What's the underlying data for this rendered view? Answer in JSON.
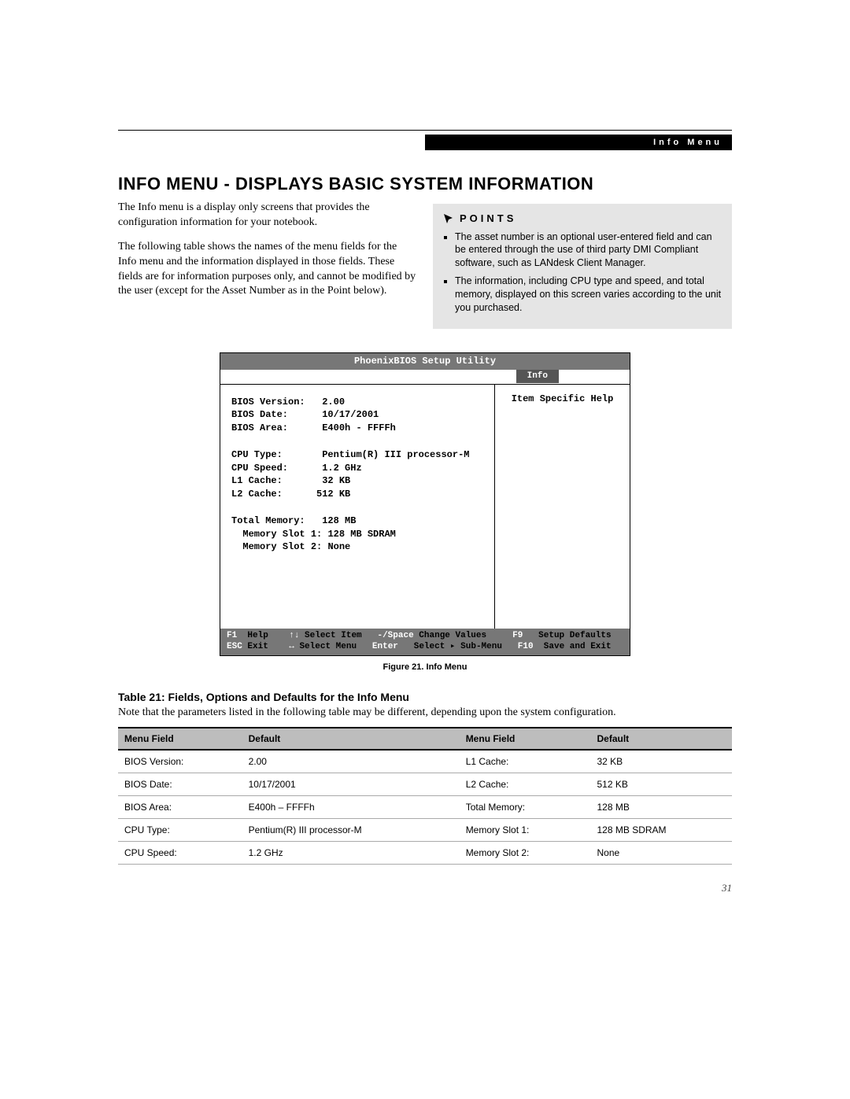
{
  "header": {
    "section_label": "Info Menu"
  },
  "heading": "INFO MENU - DISPLAYS BASIC SYSTEM INFORMATION",
  "intro": {
    "p1": "The Info menu is a display only screens that provides the configuration information for your notebook.",
    "p2": "The following table shows the names of the menu fields for the Info menu and the information displayed in those fields. These fields are for information purposes only, and cannot be modified by the user (except for the Asset Number as in the Point below)."
  },
  "points": {
    "title": "POINTS",
    "items": [
      "The asset number is an optional user-entered field and can be entered through the use of third party DMI Compliant software, such as LANdesk Client Manager.",
      "The information, including CPU type and speed, and total memory, displayed on this screen varies according to the unit you purchased."
    ]
  },
  "bios": {
    "title": "PhoenixBIOS Setup Utility",
    "tab": "Info",
    "help_title": "Item Specific Help",
    "fields": {
      "bios_version_label": "BIOS Version:",
      "bios_version": "2.00",
      "bios_date_label": "BIOS Date:",
      "bios_date": "10/17/2001",
      "bios_area_label": "BIOS Area:",
      "bios_area": "E400h - FFFFh",
      "cpu_type_label": "CPU Type:",
      "cpu_type": "Pentium(R) III processor-M",
      "cpu_speed_label": "CPU Speed:",
      "cpu_speed": "1.2 GHz",
      "l1_label": "L1 Cache:",
      "l1": " 32 KB",
      "l2_label": "L2 Cache:",
      "l2": "512 KB",
      "total_mem_label": "Total Memory:",
      "total_mem": " 128 MB",
      "slot1_label": "Memory Slot 1:",
      "slot1": "128 MB SDRAM",
      "slot2_label": "Memory Slot 2:",
      "slot2": "None"
    },
    "footer": {
      "f1": "F1",
      "help": "Help",
      "sel_item": "Select Item",
      "change_key": "-/Space",
      "change": "Change Values",
      "f9": "F9",
      "setup_def": "Setup Defaults",
      "esc": "ESC",
      "exit": "Exit",
      "sel_menu": "Select Menu",
      "enter": "Enter",
      "sel_sub": "Select ▸ Sub-Menu",
      "f10": "F10",
      "save_exit": "Save and Exit"
    }
  },
  "figure_caption": "Figure 21.  Info Menu",
  "table": {
    "caption": "Table 21: Fields, Options and Defaults for the Info Menu",
    "note": "Note that the parameters listed in the following table may be different, depending upon the system configuration.",
    "headers": [
      "Menu Field",
      "Default",
      "Menu Field",
      "Default"
    ],
    "rows": [
      [
        "BIOS Version:",
        "2.00",
        "L1 Cache:",
        "32 KB"
      ],
      [
        "BIOS Date:",
        "10/17/2001",
        "L2 Cache:",
        "512 KB"
      ],
      [
        "BIOS Area:",
        "E400h – FFFFh",
        "Total Memory:",
        "128 MB"
      ],
      [
        "CPU Type:",
        "Pentium(R) III processor-M",
        "Memory Slot 1:",
        "128 MB SDRAM"
      ],
      [
        "CPU Speed:",
        "1.2 GHz",
        "Memory Slot 2:",
        "None"
      ]
    ]
  },
  "page_number": "31"
}
